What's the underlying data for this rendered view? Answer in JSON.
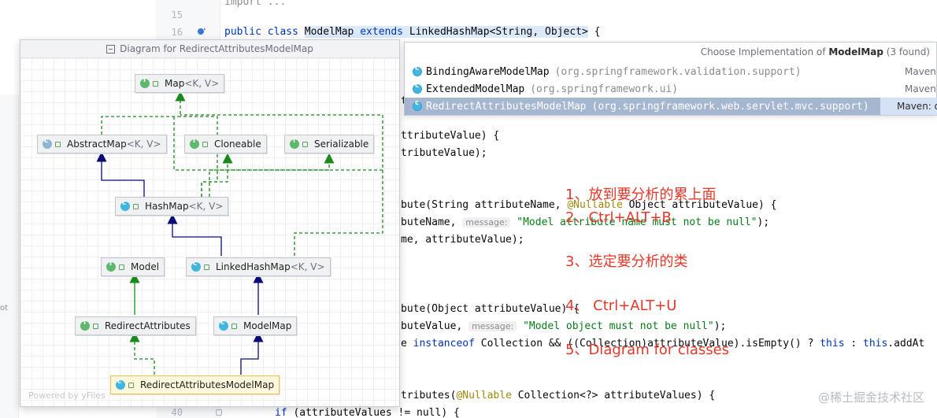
{
  "editor": {
    "line_numbers": [
      {
        "n": "15"
      },
      {
        "n": "16"
      },
      {
        "n": "40"
      }
    ],
    "top_line": "import ...",
    "decl": {
      "kw1": "public",
      "kw2": "class",
      "cls": "ModelMap",
      "kw3": "extends",
      "parent": "LinkedHashMap<String, Object>",
      "brace": "{"
    },
    "line_t": "t",
    "line_a1": "ttributeValue) {",
    "line_a2": "tributeValue);",
    "line_b1": {
      "pre": "bute(String attributeName, ",
      "anno": "@Nullable",
      "post": " Object attributeValue) {"
    },
    "line_b2": {
      "pre": "buteName, ",
      "hint": "message:",
      "str": "\"Model attribute name must not be null\"",
      "post": ");"
    },
    "line_b3": "me, attributeValue);",
    "line_c1": "bute(Object attributeValue) {",
    "line_c2": {
      "pre": "buteValue, ",
      "hint": "message:",
      "str": "\"Model object must not be null\"",
      "post": ");"
    },
    "line_c3": {
      "pre": "e ",
      "kw": "instanceof",
      "mid": " Collection && ((Collection)attributeValue).isEmpty() ? ",
      "kw2": "this",
      "mid2": " : ",
      "kw3": "this",
      "post": ".addAt"
    },
    "line_d1": {
      "pre": "tributes(",
      "anno": "@Nullable",
      "post": " Collection<?> attributeValues) {"
    },
    "line_d2": {
      "kw": "if",
      "post": " (attributeValues != null) {"
    },
    "left_cut": "ot"
  },
  "notes": {
    "n1": "1、放到要分析的累上面",
    "n2": "2、Ctrl+ALT+B",
    "n3": "3、选定要分析的类",
    "n4": "4、 Ctrl+ALT+U",
    "n5": "5、Diagram for classes"
  },
  "watermark": "@稀土掘金技术社区",
  "impl_popup": {
    "title_pre": "Choose Implementation of ",
    "title_bold": "ModelMap",
    "title_post": " (3 found)",
    "rows": [
      {
        "name": "BindingAwareModelMap",
        "pkg": "(org.springframework.validation.support)",
        "maven": "Maven:"
      },
      {
        "name": "ExtendedModelMap",
        "pkg": "(org.springframework.ui)",
        "maven": "Maven:"
      },
      {
        "name": "RedirectAttributesModelMap",
        "pkg": "(org.springframework.web.servlet.mvc.support)",
        "maven": "Maven: o"
      }
    ]
  },
  "diagram": {
    "title": "Diagram for RedirectAttributesModelMap",
    "powered": "Powered by yFiles",
    "nodes": {
      "map": {
        "name": "Map",
        "gen": "<K, V>"
      },
      "abstractmap": {
        "name": "AbstractMap",
        "gen": "<K, V>"
      },
      "cloneable": {
        "name": "Cloneable"
      },
      "serializable": {
        "name": "Serializable"
      },
      "hashmap": {
        "name": "HashMap",
        "gen": "<K, V>"
      },
      "model": {
        "name": "Model"
      },
      "linkedhashmap": {
        "name": "LinkedHashMap",
        "gen": "<K, V>"
      },
      "redirectattributes": {
        "name": "RedirectAttributes"
      },
      "modelmap": {
        "name": "ModelMap"
      },
      "ramm": {
        "name": "RedirectAttributesModelMap"
      }
    },
    "colors": {
      "extends": "#0b0b7a",
      "implements": "#1a8a1a",
      "selected_border": "#e8c44e"
    }
  }
}
